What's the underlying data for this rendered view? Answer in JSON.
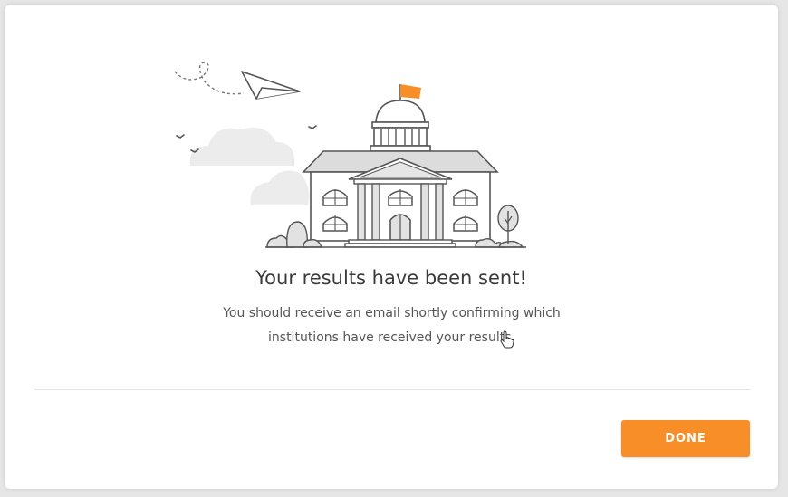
{
  "modal": {
    "title": "Your results have been sent!",
    "message": "You should receive an email shortly confirming which institutions have received your results.",
    "done_label": "DONE"
  },
  "illustration": {
    "icon": "university-building-illustration",
    "flag_color": "#f88e27",
    "line_color": "#666666"
  },
  "colors": {
    "accent": "#f88e27",
    "title_text": "#3a3a3a",
    "body_text": "#555555"
  }
}
